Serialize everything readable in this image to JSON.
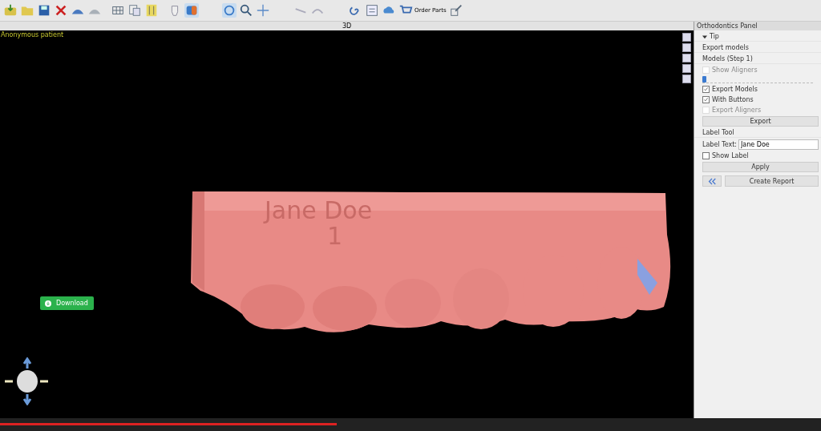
{
  "toolbar": {
    "order_parts": "Order Parts"
  },
  "view": {
    "title": "3D",
    "patient": "Anonymous patient",
    "model_label": "Jane Doe",
    "model_number": "1",
    "download": "Download"
  },
  "panel": {
    "title": "Orthodontics Panel",
    "tip": "Tip",
    "tip_expanded": true,
    "section": "Export models",
    "models_step": "Models (Step 1)",
    "checks": [
      {
        "label": "Show Aligners",
        "checked": false,
        "disabled": true
      },
      {
        "kind": "slider",
        "level": 0.0
      },
      {
        "label": "Export Models",
        "checked": true,
        "disabled": false
      },
      {
        "label": "With Buttons",
        "checked": true,
        "disabled": false
      },
      {
        "label": "Export Aligners",
        "checked": false,
        "disabled": true
      }
    ],
    "export_button": "Export",
    "label_tool": "Label Tool",
    "label_text_label": "Label Text:",
    "label_text_value": "Jane Doe",
    "show_label": {
      "label": "Show Label",
      "checked": false
    },
    "apply_button": "Apply",
    "create_report": "Create Report"
  },
  "player": {
    "level": 0.41
  }
}
